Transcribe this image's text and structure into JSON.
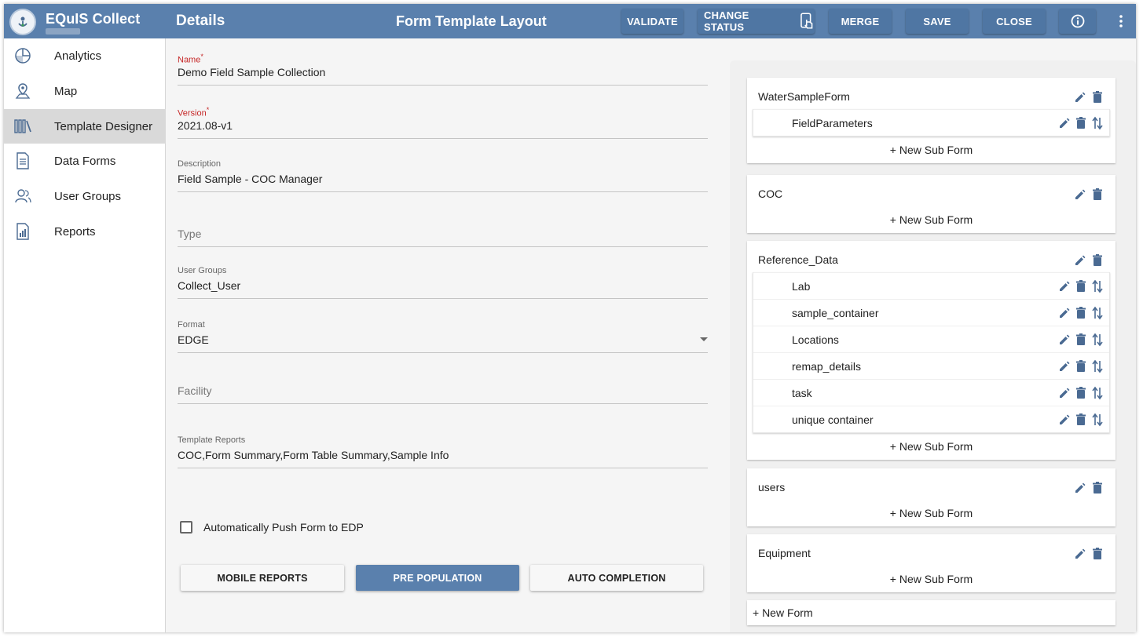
{
  "header": {
    "app_title": "EQuIS Collect",
    "section_title": "Details",
    "layout_title": "Form Template Layout",
    "buttons": {
      "validate": "VALIDATE",
      "change_status": "CHANGE STATUS",
      "merge": "MERGE",
      "save": "SAVE",
      "close": "CLOSE"
    }
  },
  "sidebar": {
    "items": [
      {
        "label": "Analytics",
        "icon": "pie-chart-icon"
      },
      {
        "label": "Map",
        "icon": "map-pin-icon"
      },
      {
        "label": "Template Designer",
        "icon": "library-icon",
        "active": true
      },
      {
        "label": "Data Forms",
        "icon": "document-icon"
      },
      {
        "label": "User Groups",
        "icon": "users-icon"
      },
      {
        "label": "Reports",
        "icon": "report-icon"
      }
    ]
  },
  "details": {
    "name": {
      "label": "Name",
      "required_mark": "*",
      "value": "Demo Field Sample Collection"
    },
    "version": {
      "label": "Version",
      "required_mark": "*",
      "value": "2021.08-v1"
    },
    "description": {
      "label": "Description",
      "value": "Field Sample - COC Manager"
    },
    "type": {
      "placeholder": "Type"
    },
    "user_groups": {
      "label": "User Groups",
      "value": "Collect_User"
    },
    "format": {
      "label": "Format",
      "value": "EDGE"
    },
    "facility": {
      "placeholder": "Facility"
    },
    "template_reports": {
      "label": "Template Reports",
      "value": "COC,Form Summary,Form Table Summary,Sample Info"
    },
    "auto_push": {
      "label": "Automatically Push Form to EDP",
      "checked": false
    },
    "buttons": {
      "mobile_reports": "MOBILE REPORTS",
      "pre_population": "PRE POPULATION",
      "auto_completion": "AUTO COMPLETION"
    }
  },
  "layout": {
    "new_sub_form_label": "+ New Sub Form",
    "new_form_label": "+ New Form",
    "forms": [
      {
        "name": "WaterSampleForm",
        "sub_forms": [
          "FieldParameters"
        ]
      },
      {
        "name": "COC",
        "sub_forms": []
      },
      {
        "name": "Reference_Data",
        "sub_forms": [
          "Lab",
          "sample_container",
          "Locations",
          "remap_details",
          "task",
          "unique container"
        ]
      },
      {
        "name": "users",
        "sub_forms": []
      },
      {
        "name": "Equipment",
        "sub_forms": []
      }
    ]
  },
  "colors": {
    "header_bg": "#5a80ad",
    "required": "#c62828",
    "icon": "#4a6a92"
  }
}
